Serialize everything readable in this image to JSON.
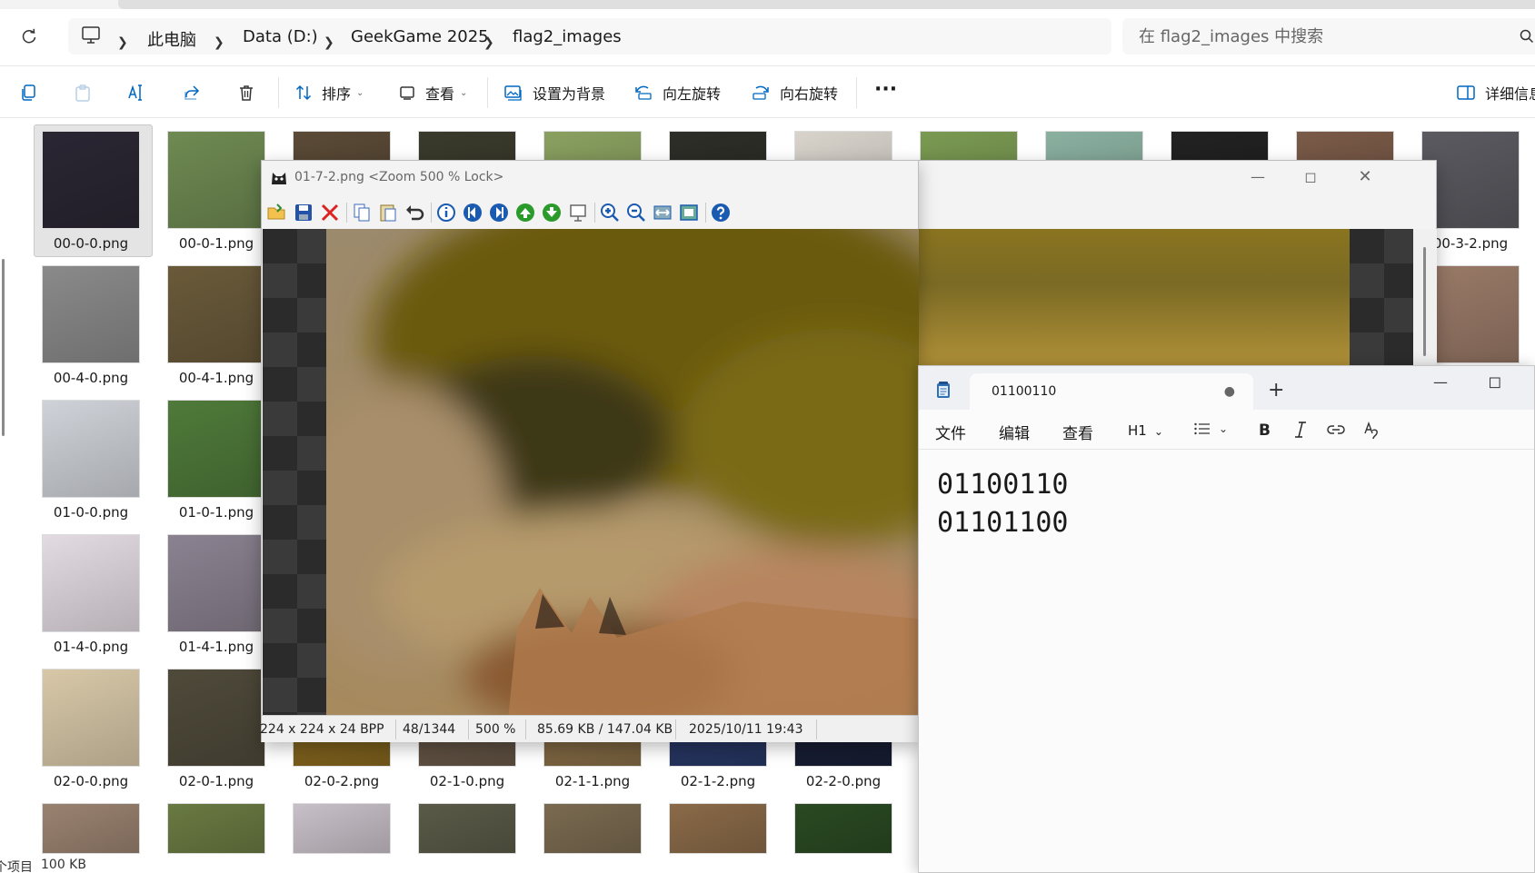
{
  "explorer": {
    "breadcrumb": [
      "此电脑",
      "Data (D:)",
      "GeekGame 2025",
      "flag2_images"
    ],
    "search_placeholder": "在 flag2_images 中搜索",
    "commands": {
      "sort_label": "排序",
      "view_label": "查看",
      "set_background_label": "设置为背景",
      "rotate_left_label": "向左旋转",
      "rotate_right_label": "向右旋转",
      "details_label": "详细信息"
    },
    "files": [
      {
        "name": "00-0-0.png",
        "color": "#2a2633",
        "selected": true
      },
      {
        "name": "00-0-1.png",
        "color": "#6f8a52"
      },
      {
        "name": "",
        "color": "#5a4a36"
      },
      {
        "name": "",
        "color": "#3a3a2c"
      },
      {
        "name": "",
        "color": "#8aa060"
      },
      {
        "name": "",
        "color": "#2e2e28"
      },
      {
        "name": "",
        "color": "#d8d4cc"
      },
      {
        "name": "",
        "color": "#7a9a52"
      },
      {
        "name": "",
        "color": "#8ab0a0"
      },
      {
        "name": "",
        "color": "#222222"
      },
      {
        "name": "",
        "color": "#7a5a48"
      },
      {
        "name": "00-3-2.png",
        "color": "#5a5a60"
      },
      {
        "name": "00-4-0.png",
        "color": "#8a8a8a"
      },
      {
        "name": "00-4-1.png",
        "color": "#6a5a3a"
      },
      {
        "name": "01-0-0.png",
        "color": "#cfd2d8"
      },
      {
        "name": "01-0-1.png",
        "color": "#4f7a3a"
      },
      {
        "name": "01-4-0.png",
        "color": "#e3dbe2"
      },
      {
        "name": "01-4-1.png",
        "color": "#8a8290"
      },
      {
        "name": "02-0-0.png",
        "color": "#d8c8a8"
      },
      {
        "name": "02-0-1.png",
        "color": "#4f4a3a"
      },
      {
        "name": "02-0-2.png",
        "color": "#8a6a20"
      },
      {
        "name": "02-1-0.png",
        "color": "#6a5a4a"
      },
      {
        "name": "02-1-1.png",
        "color": "#8a7048"
      },
      {
        "name": "02-1-2.png",
        "color": "#2a3a6a"
      },
      {
        "name": "02-2-0.png",
        "color": "#1a2038"
      },
      {
        "name": "",
        "color": "#9a8270"
      },
      {
        "name": "",
        "color": "#6a7a42"
      },
      {
        "name": "",
        "color": "#c8c0c8"
      },
      {
        "name": "",
        "color": "#5a5a48"
      },
      {
        "name": "",
        "color": "#7a6a50"
      },
      {
        "name": "",
        "color": "#8a6a48"
      },
      {
        "name": "",
        "color": "#2a4a22"
      },
      {
        "name": "",
        "color": "#9a7a68"
      }
    ],
    "status_items": "个项目",
    "status_size": "100 KB"
  },
  "viewer": {
    "title": "01-7-2.png <Zoom 500 % Lock>",
    "status": [
      "224 x 224 x 24 BPP",
      "48/1344",
      "500 %",
      "85.69 KB / 147.04 KB",
      "2025/10/11 19:43"
    ]
  },
  "notepad": {
    "tab_title": "01100110",
    "menu": [
      "文件",
      "编辑",
      "查看"
    ],
    "heading": "H1",
    "content": "01100110\n01101100"
  },
  "colors": {
    "accent": "#0067c0",
    "selection": "#e4e4e4",
    "notepad_tabbar": "#eef0f3"
  }
}
